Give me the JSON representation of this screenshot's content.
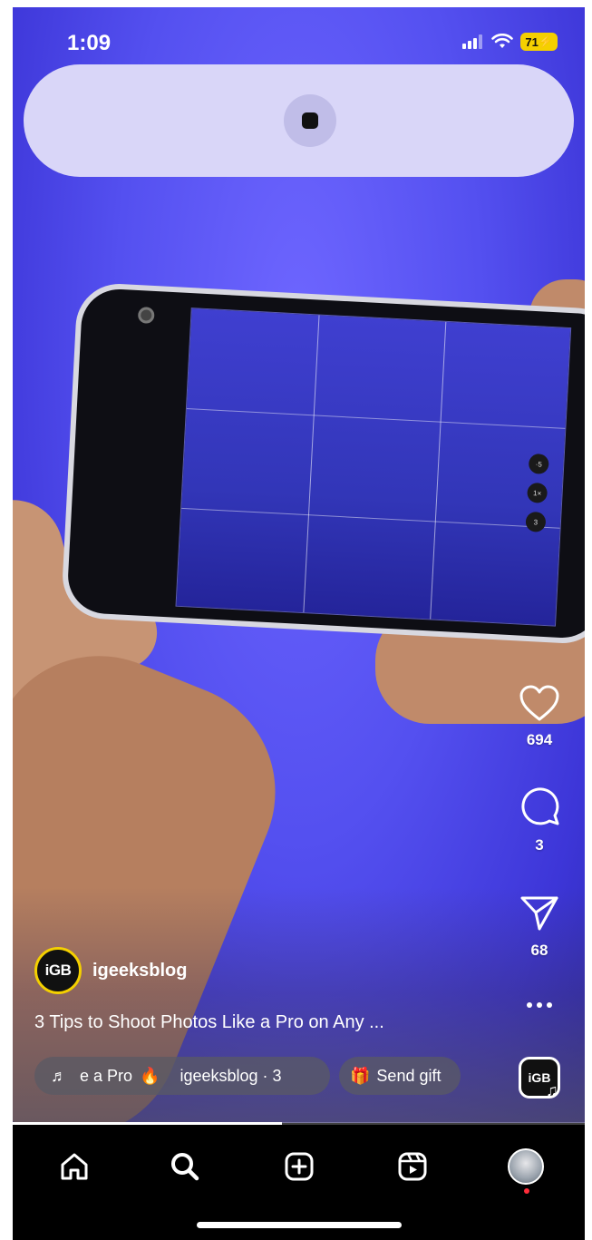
{
  "status_bar": {
    "time": "1:09",
    "battery": "71"
  },
  "post": {
    "username": "igeeksblog",
    "avatar_text": "iGB",
    "caption": "3 Tips to Shoot Photos Like a Pro on Any ...",
    "audio": {
      "title_fragment": "e a Pro",
      "artist_line": "igeeksblog · 3"
    },
    "gift_label": "Send gift",
    "audio_thumb_text": "iGB"
  },
  "actions": {
    "likes": "694",
    "comments": "3",
    "shares": "68"
  },
  "playback": {
    "progress_percent": 47
  },
  "nav": {
    "items": [
      "home",
      "search",
      "create",
      "reels",
      "profile"
    ]
  },
  "colors": {
    "video_bg": "#5450f0",
    "recording_pill": "#d9d6f8",
    "battery": "#f4d000",
    "notification_dot": "#ff2d3a"
  }
}
